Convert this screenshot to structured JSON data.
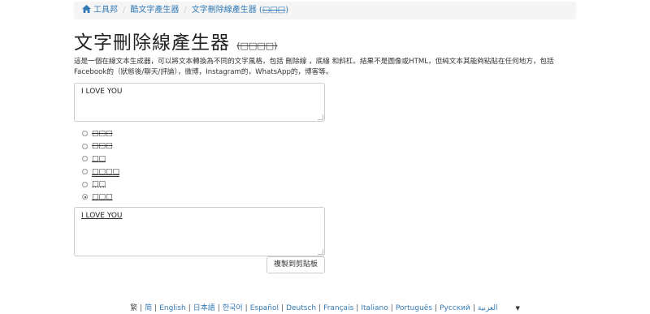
{
  "breadcrumb": {
    "items": [
      {
        "label": "工具邦"
      },
      {
        "label": "酷文字產生器"
      },
      {
        "label": "文字刪除線產生器 ("
      },
      {
        "label": "□□□"
      },
      {
        "label": ")"
      }
    ]
  },
  "title": {
    "main": "文字刪除線產生器",
    "sub": "(□□□□)"
  },
  "description": "這是一個在線文本生成器，可以將文本轉換為不同的文字風格，包括 刪除線 ，底線 和斜杠。結果不是圖像或HTML，但純文本其能夠粘貼在任何地方，包括Facebook的（狀態後/聊天/評論），微博，Instagram的，WhatsApp的，博客等。",
  "input": {
    "value": "I LOVE YOU"
  },
  "options": [
    {
      "label": "□□□"
    },
    {
      "label": "□□□"
    },
    {
      "label": "□□"
    },
    {
      "label": "□□□□"
    },
    {
      "label": "□□"
    },
    {
      "label": "□□□"
    }
  ],
  "output": {
    "value": "I LOVE YOU"
  },
  "copy_button": "複製到剪貼板",
  "languages": [
    "繁",
    "简",
    "English",
    "日本語",
    "한국어",
    "Español",
    "Deutsch",
    "Français",
    "Italiano",
    "Português",
    "Русский",
    "العربية"
  ],
  "dropdown_glyph": "▼"
}
